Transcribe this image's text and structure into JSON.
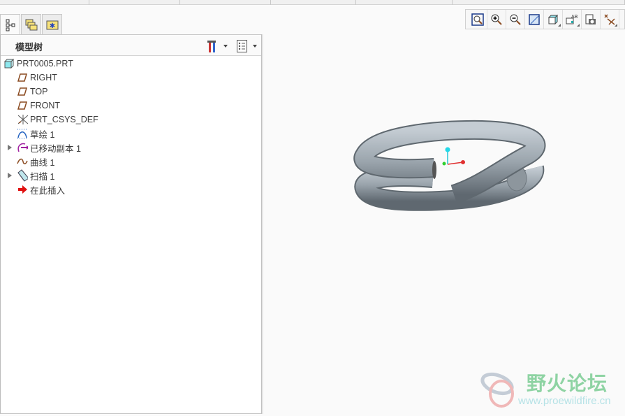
{
  "panel": {
    "title": "模型树"
  },
  "tree": [
    {
      "label": "PRT0005.PRT",
      "icon": "part-icon",
      "expandable": false
    },
    {
      "label": "RIGHT",
      "icon": "datum-plane-icon",
      "expandable": false
    },
    {
      "label": "TOP",
      "icon": "datum-plane-icon",
      "expandable": false
    },
    {
      "label": "FRONT",
      "icon": "datum-plane-icon",
      "expandable": false
    },
    {
      "label": "PRT_CSYS_DEF",
      "icon": "csys-icon",
      "expandable": false
    },
    {
      "label": "草绘 1",
      "icon": "sketch-icon",
      "expandable": false
    },
    {
      "label": "已移动副本 1",
      "icon": "moved-copy-icon",
      "expandable": true
    },
    {
      "label": "曲线 1",
      "icon": "curve-icon",
      "expandable": false
    },
    {
      "label": "扫描 1",
      "icon": "sweep-icon",
      "expandable": true
    },
    {
      "label": "在此插入",
      "icon": "insert-here-icon",
      "expandable": false
    }
  ],
  "toolbar": [
    "refit-icon",
    "zoom-in-icon",
    "zoom-out-icon",
    "repaint-icon",
    "display-style-icon",
    "saved-views-icon",
    "view-manager-icon",
    "datum-display-icon"
  ],
  "watermark": {
    "name": "野火论坛",
    "url": "www.proewildfire.cn"
  }
}
